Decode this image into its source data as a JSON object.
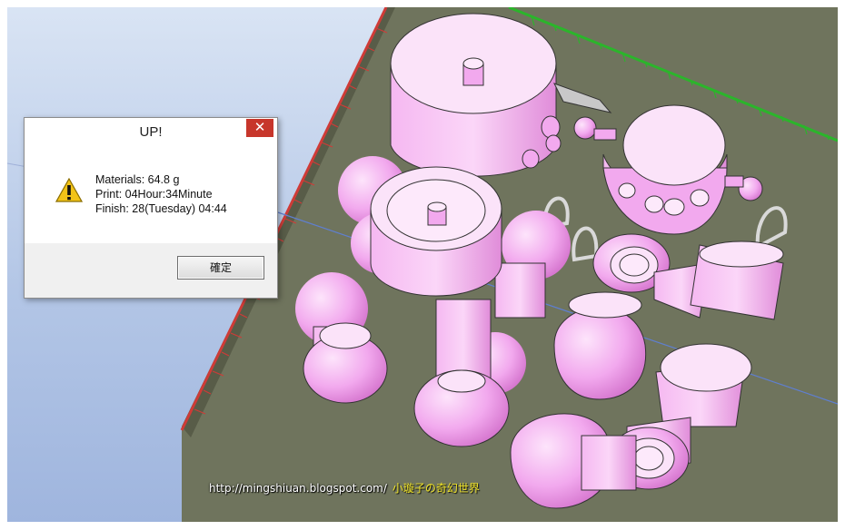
{
  "dialog": {
    "title": "UP!",
    "close_glyph": "✕",
    "icon": "warning-icon",
    "lines": [
      "Materials: 64.8 g",
      "Print: 04Hour:34Minute",
      "Finish: 28(Tuesday) 04:44"
    ],
    "ok_label": "確定"
  },
  "watermark": {
    "url": "http://mingshiuan.blogspot.com/",
    "site_name": "小璇子の奇幻世界"
  },
  "colors": {
    "model": "#f2a9ee",
    "platform": "#6f745d",
    "ruler_red": "#cf3b37",
    "ruler_green": "#2bb52b",
    "warning": "#f2c318"
  }
}
